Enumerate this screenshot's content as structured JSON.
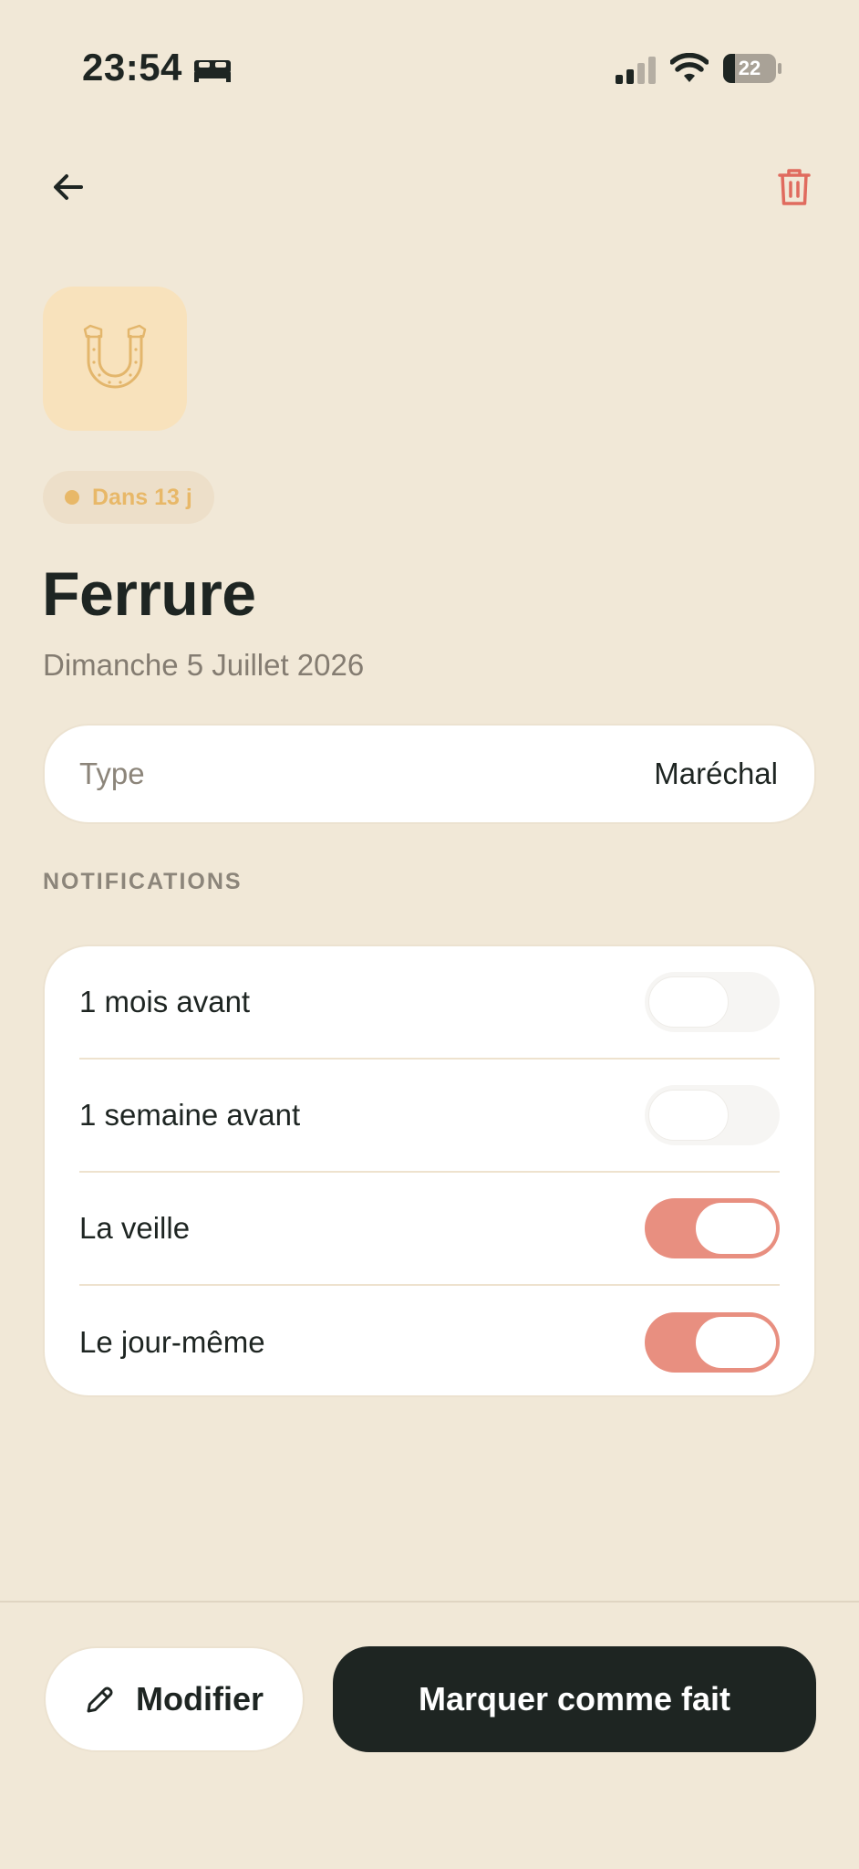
{
  "status_bar": {
    "time": "23:54",
    "focus_icon": "bed-icon",
    "signal_icon": "cellular-signal-icon",
    "wifi_icon": "wifi-icon",
    "battery_level": "22",
    "battery_fraction": 0.22
  },
  "nav": {
    "back_icon": "arrow-left-icon",
    "delete_icon": "trash-icon",
    "delete_color": "#E06B5E"
  },
  "event": {
    "icon": "horseshoe-icon",
    "icon_color": "#E3B66C",
    "tile_color": "#F8E2BC",
    "badge": "Dans 13 j",
    "badge_color": "#E8B868",
    "title": "Ferrure",
    "date": "Dimanche 5 Juillet 2026"
  },
  "type_row": {
    "label": "Type",
    "value": "Maréchal"
  },
  "notifications": {
    "section_label": "NOTIFICATIONS",
    "items": [
      {
        "label": "1 mois avant",
        "enabled": false
      },
      {
        "label": "1 semaine avant",
        "enabled": false
      },
      {
        "label": "La veille",
        "enabled": true
      },
      {
        "label": "Le jour-même",
        "enabled": true
      }
    ],
    "toggle_on_color": "#E88F80"
  },
  "actions": {
    "modify_label": "Modifier",
    "modify_icon": "pencil-icon",
    "done_label": "Marquer comme fait"
  },
  "colors": {
    "background": "#F1E8D7",
    "primary_dark": "#1E2522",
    "muted_text": "#847C71"
  }
}
